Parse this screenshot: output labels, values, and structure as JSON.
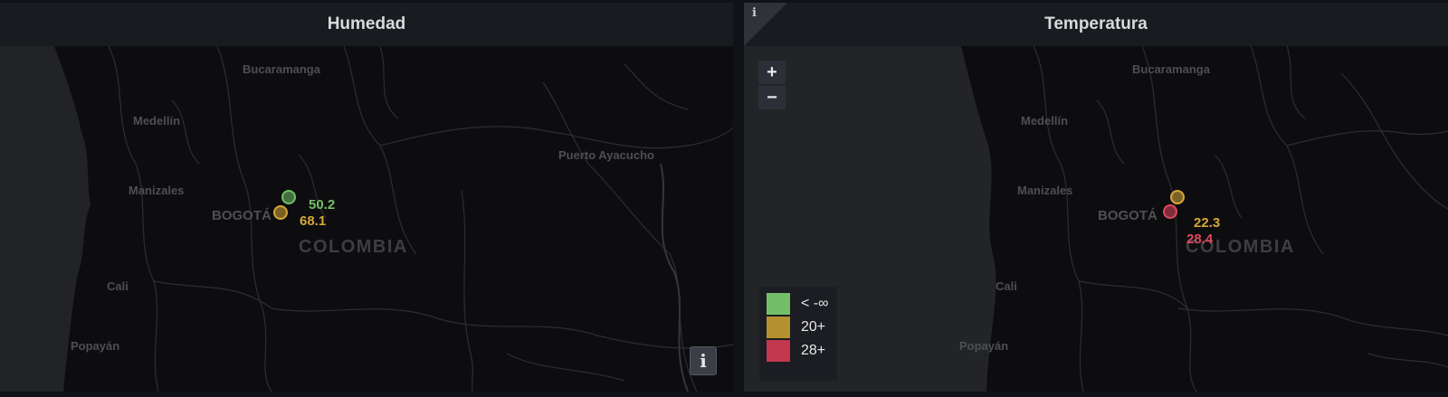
{
  "panels": {
    "humedad": {
      "title": "Humedad",
      "cities": {
        "bucaramanga": "Bucaramanga",
        "medellin": "Medellín",
        "manizales": "Manizales",
        "bogota": "BOGOTÁ",
        "cali": "Cali",
        "popayan": "Popayán",
        "puerto_ayacucho": "Puerto Ayacucho"
      },
      "country": "COLOMBIA",
      "readings": [
        {
          "value": "50.2",
          "status": "green"
        },
        {
          "value": "68.1",
          "status": "yellow"
        }
      ],
      "info_button": "i"
    },
    "temperatura": {
      "title": "Temperatura",
      "info_corner": "i",
      "zoom_in": "+",
      "zoom_out": "−",
      "cities": {
        "bucaramanga": "Bucaramanga",
        "medellin": "Medellín",
        "manizales": "Manizales",
        "bogota": "BOGOTÁ",
        "cali": "Cali",
        "popayan": "Popayán"
      },
      "country": "COLOMBIA",
      "readings": [
        {
          "value": "22.3",
          "status": "yellow"
        },
        {
          "value": "28.4",
          "status": "red"
        }
      ],
      "legend": [
        {
          "label": "< -∞",
          "color": "#73bf69"
        },
        {
          "label": "20+",
          "color": "#b6912f"
        },
        {
          "label": "28+",
          "color": "#c4384f"
        }
      ]
    }
  },
  "colors": {
    "green": "#73bf69",
    "yellow": "#d6a73a",
    "red": "#e0475d"
  }
}
